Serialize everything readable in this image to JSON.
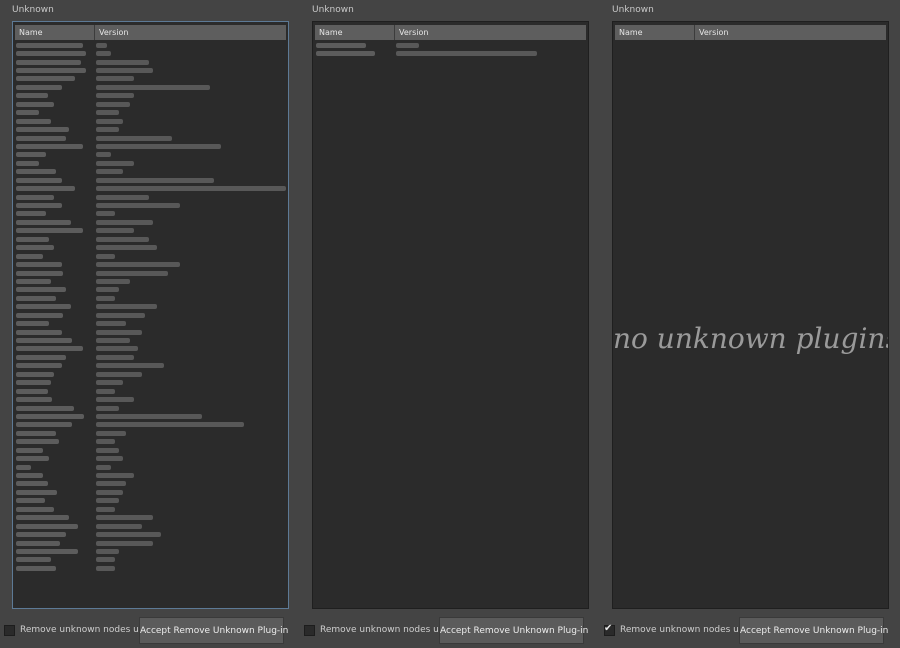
{
  "panels": [
    {
      "title": "Unknown",
      "columns": {
        "name": "Name",
        "version": "Version"
      },
      "rows": [
        {
          "n": 0.88,
          "v": 0.06
        },
        {
          "n": 0.92,
          "v": 0.08
        },
        {
          "n": 0.86,
          "v": 0.28
        },
        {
          "n": 0.92,
          "v": 0.3
        },
        {
          "n": 0.78,
          "v": 0.2
        },
        {
          "n": 0.6,
          "v": 0.6
        },
        {
          "n": 0.42,
          "v": 0.2
        },
        {
          "n": 0.5,
          "v": 0.18
        },
        {
          "n": 0.3,
          "v": 0.12
        },
        {
          "n": 0.46,
          "v": 0.14
        },
        {
          "n": 0.7,
          "v": 0.12
        },
        {
          "n": 0.66,
          "v": 0.4
        },
        {
          "n": 0.88,
          "v": 0.66
        },
        {
          "n": 0.4,
          "v": 0.08
        },
        {
          "n": 0.3,
          "v": 0.2
        },
        {
          "n": 0.52,
          "v": 0.14
        },
        {
          "n": 0.6,
          "v": 0.62
        },
        {
          "n": 0.78,
          "v": 1.0
        },
        {
          "n": 0.5,
          "v": 0.28
        },
        {
          "n": 0.6,
          "v": 0.44
        },
        {
          "n": 0.4,
          "v": 0.1
        },
        {
          "n": 0.72,
          "v": 0.3
        },
        {
          "n": 0.88,
          "v": 0.2
        },
        {
          "n": 0.44,
          "v": 0.28
        },
        {
          "n": 0.5,
          "v": 0.32
        },
        {
          "n": 0.36,
          "v": 0.1
        },
        {
          "n": 0.6,
          "v": 0.44
        },
        {
          "n": 0.62,
          "v": 0.38
        },
        {
          "n": 0.46,
          "v": 0.18
        },
        {
          "n": 0.66,
          "v": 0.12
        },
        {
          "n": 0.52,
          "v": 0.1
        },
        {
          "n": 0.72,
          "v": 0.32
        },
        {
          "n": 0.62,
          "v": 0.26
        },
        {
          "n": 0.44,
          "v": 0.16
        },
        {
          "n": 0.6,
          "v": 0.24
        },
        {
          "n": 0.74,
          "v": 0.18
        },
        {
          "n": 0.88,
          "v": 0.22
        },
        {
          "n": 0.66,
          "v": 0.2
        },
        {
          "n": 0.6,
          "v": 0.36
        },
        {
          "n": 0.5,
          "v": 0.24
        },
        {
          "n": 0.46,
          "v": 0.14
        },
        {
          "n": 0.42,
          "v": 0.1
        },
        {
          "n": 0.48,
          "v": 0.2
        },
        {
          "n": 0.76,
          "v": 0.12
        },
        {
          "n": 0.9,
          "v": 0.56
        },
        {
          "n": 0.74,
          "v": 0.78
        },
        {
          "n": 0.52,
          "v": 0.16
        },
        {
          "n": 0.56,
          "v": 0.1
        },
        {
          "n": 0.36,
          "v": 0.12
        },
        {
          "n": 0.44,
          "v": 0.14
        },
        {
          "n": 0.2,
          "v": 0.08
        },
        {
          "n": 0.36,
          "v": 0.2
        },
        {
          "n": 0.42,
          "v": 0.16
        },
        {
          "n": 0.54,
          "v": 0.14
        },
        {
          "n": 0.38,
          "v": 0.12
        },
        {
          "n": 0.5,
          "v": 0.1
        },
        {
          "n": 0.7,
          "v": 0.3
        },
        {
          "n": 0.82,
          "v": 0.24
        },
        {
          "n": 0.66,
          "v": 0.34
        },
        {
          "n": 0.58,
          "v": 0.3
        },
        {
          "n": 0.82,
          "v": 0.12
        },
        {
          "n": 0.46,
          "v": 0.1
        },
        {
          "n": 0.52,
          "v": 0.1
        }
      ],
      "empty_text": "",
      "checkbox": {
        "label": "Remove unknown nodes used",
        "checked": false
      },
      "button_label": "Accept Remove Unknown Plug-in"
    },
    {
      "title": "Unknown",
      "columns": {
        "name": "Name",
        "version": "Version"
      },
      "rows": [
        {
          "n": 0.66,
          "v": 0.12
        },
        {
          "n": 0.78,
          "v": 0.74
        }
      ],
      "empty_text": "",
      "checkbox": {
        "label": "Remove unknown nodes used",
        "checked": false
      },
      "button_label": "Accept Remove Unknown Plug-in"
    },
    {
      "title": "Unknown",
      "columns": {
        "name": "Name",
        "version": "Version"
      },
      "rows": [],
      "empty_text": "no unknown plugins.",
      "checkbox": {
        "label": "Remove unknown nodes used",
        "checked": true,
        "mark": "✔"
      },
      "button_label": "Accept Remove Unknown Plug-in"
    }
  ]
}
